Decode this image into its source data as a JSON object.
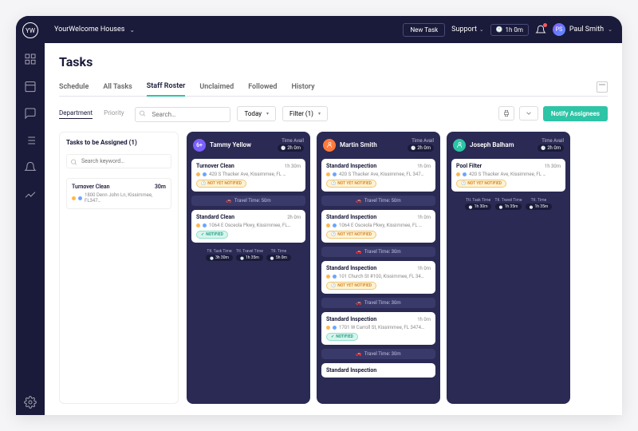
{
  "header": {
    "org": "YourWelcome Houses",
    "new_task": "New Task",
    "support": "Support",
    "time_pill": "1h 0m",
    "user_name": "Paul Smith",
    "user_initials": "PS"
  },
  "page": {
    "title": "Tasks"
  },
  "tabs": [
    "Schedule",
    "All Tasks",
    "Staff Roster",
    "Unclaimed",
    "Followed",
    "History"
  ],
  "active_tab": "Staff Roster",
  "subtabs": [
    "Department",
    "Priority"
  ],
  "active_subtab": "Department",
  "search_placeholder": "Search…",
  "date_filter": "Today",
  "filter_label": "Filter (1)",
  "notify_btn": "Notify Assignees",
  "assign": {
    "title": "Tasks to be Assigned (1)",
    "search_placeholder": "Search keyword…",
    "card": {
      "title": "Turnover Clean",
      "duration": "30m",
      "address": "1800 Denn John Ln, Kissimmee, FL347…"
    }
  },
  "columns": [
    {
      "avatar_color": "#7b5fff",
      "avatar_text": "6+",
      "name": "Tammy Yellow",
      "time_avail_label": "Time Avail",
      "time_avail": "2h 0m",
      "cards": [
        {
          "title": "Turnover Clean",
          "dur": "1h 30m",
          "addr": "420 S Thacker Ave, Kissimmee, FL …",
          "status": "warn",
          "status_label": "NOT YET NOTIFIED"
        },
        {
          "travel": "Travel Time: 50m"
        },
        {
          "title": "Standard Clean",
          "dur": "2h 0m",
          "addr": "1064 E Osceola Pkwy, Kissimmee, FL…",
          "status": "ok",
          "status_label": "NOTIFIED"
        }
      ],
      "totals": [
        {
          "label": "Ttl. Task Time",
          "value": "3h 30m"
        },
        {
          "label": "Ttl. Travel Time",
          "value": "1h 35m"
        },
        {
          "label": "Ttl. Time",
          "value": "5h 0m"
        }
      ]
    },
    {
      "avatar_color": "#ff7a3d",
      "avatar_text": "",
      "name": "Martin Smith",
      "time_avail_label": "Time Avail",
      "time_avail": "2h 0m",
      "cards": [
        {
          "title": "Standard Inspection",
          "dur": "1h 0m",
          "addr": "420 S Thacker Ave, Kissimmee, FL 347…",
          "status": "warn",
          "status_label": "NOT YET NOTIFIED"
        },
        {
          "travel": "Travel Time: 50m"
        },
        {
          "title": "Standard Inspection",
          "dur": "1h 0m",
          "addr": "1064 E Osceola Pkwy, Kissimmee, FL …",
          "status": "warn",
          "status_label": "NOT YET NOTIFIED"
        },
        {
          "travel": "Travel Time: 30m"
        },
        {
          "title": "Standard Inspection",
          "dur": "1h 0m",
          "addr": "101 Church St #100, Kissimmee, FL 34…",
          "status": "warn",
          "status_label": "NOT YET NOTIFIED"
        },
        {
          "travel": "Travel Time: 30m"
        },
        {
          "title": "Standard Inspection",
          "dur": "1h 0m",
          "addr": "1701 W Carroll St, Kissimmee, FL 3474…",
          "status": "ok",
          "status_label": "NOTIFIED"
        },
        {
          "travel": "Travel Time: 30m"
        },
        {
          "title": "Standard Inspection",
          "dur": "",
          "addr": "",
          "status": null
        }
      ]
    },
    {
      "avatar_color": "#2ec4a6",
      "avatar_text": "",
      "name": "Joseph Balham",
      "time_avail_label": "Time Avail",
      "time_avail": "2h 0m",
      "cards": [
        {
          "title": "Pool Filter",
          "dur": "1h 30m",
          "addr": "420 S Thacker Ave, Kissimmee, FL …",
          "status": "warn",
          "status_label": "NOT YET NOTIFIED"
        }
      ],
      "totals": [
        {
          "label": "Ttl. Task Time",
          "value": "1h 30m"
        },
        {
          "label": "Ttl. Travel Time",
          "value": "1h 35m"
        },
        {
          "label": "Ttl. Time",
          "value": "1h 35m"
        }
      ]
    }
  ]
}
